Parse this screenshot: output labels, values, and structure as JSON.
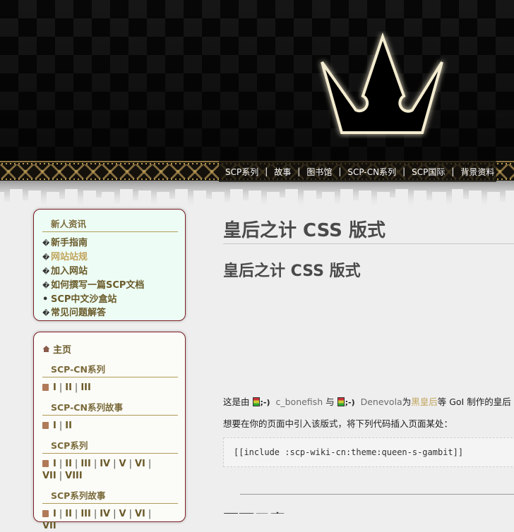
{
  "nav": {
    "items": [
      "SCP系列",
      "故事",
      "图书馆",
      "SCP-CN系列",
      "SCP国际",
      "背景资料"
    ],
    "separator": "|"
  },
  "sidebar": {
    "box1": {
      "heading": "新人资讯",
      "items": [
        {
          "marker": "�",
          "label": "新手指南"
        },
        {
          "marker": "�",
          "label": "网站站规"
        },
        {
          "marker": "�",
          "label": "加入网站"
        },
        {
          "marker": "�",
          "label": "如何撰写一篇SCP文档"
        },
        {
          "marker": "•",
          "label": "SCP中文沙盒站"
        },
        {
          "marker": "�",
          "label": "常见问题解答"
        }
      ]
    },
    "box2": {
      "home": "主页",
      "cn_series_heading": "SCP-CN系列",
      "cn_series_links": [
        "I",
        "II",
        "III"
      ],
      "cn_tales_heading": "SCP-CN系列故事",
      "cn_tales_links": [
        "I",
        "II"
      ],
      "series_heading": "SCP系列",
      "series_links_line1": [
        "I",
        "II",
        "III",
        "IV",
        "V",
        "VI"
      ],
      "series_links_line2": [
        "VII",
        "VIII"
      ],
      "tales_heading": "SCP系列故事",
      "tales_links_line1": [
        "I",
        "II",
        "III",
        "IV",
        "V",
        "VI"
      ],
      "tales_links_line2": [
        "VII"
      ]
    }
  },
  "main": {
    "page_title": "皇后之计 CSS 版式",
    "heading": "皇后之计 CSS 版式",
    "credit": {
      "prefix": "这是由",
      "user1": "c_bonefish",
      "and": "与",
      "user2": "Denevola",
      "for_text": "为",
      "link": "黑皇后",
      "suffix": "等 GoI 制作的皇后"
    },
    "instruction": "想要在你的页面中引入该版式，将下列代码插入页面某处：",
    "code": "[[include :scp-wiki-cn:theme:queen-s-gambit]]",
    "next_heading": "页面元素"
  },
  "colors": {
    "sidebar_border": "#7d1f24",
    "link_gold": "#c2a55e",
    "link_dark": "#6a5a2a",
    "header_bg": "#080808"
  },
  "icons": [
    "crown-logo",
    "home-icon",
    "image-icon",
    "user-icon"
  ]
}
